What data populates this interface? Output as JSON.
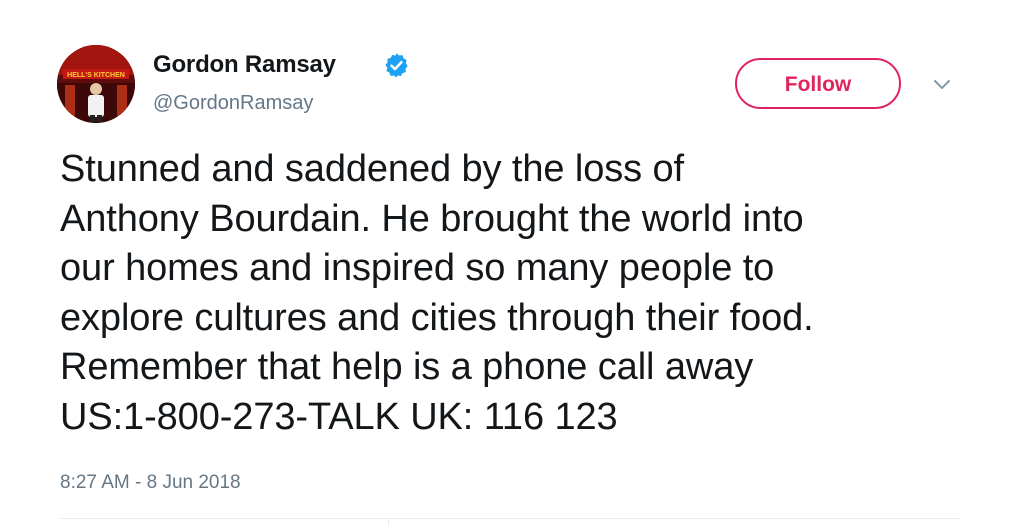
{
  "tweet": {
    "author": {
      "name": "Gordon Ramsay",
      "handle": "@GordonRamsay",
      "verified": true,
      "avatar_sign_text": "HELL'S KITCHEN"
    },
    "follow_button_label": "Follow",
    "menu_icon": "chevron-down-icon",
    "text_lines": [
      "Stunned and saddened by the loss of",
      "Anthony Bourdain. He brought the world into",
      "our homes and inspired so many people to",
      "explore cultures and cities through their food.",
      "Remember that help is a phone call away",
      "US:1-800-273-TALK UK: 116 123"
    ],
    "timestamp": "8:27 AM - 8 Jun 2018"
  },
  "colors": {
    "accent": "#e0245e",
    "verified_blue": "#1da1f2",
    "secondary_text": "#657786",
    "primary_text": "#14171a"
  }
}
